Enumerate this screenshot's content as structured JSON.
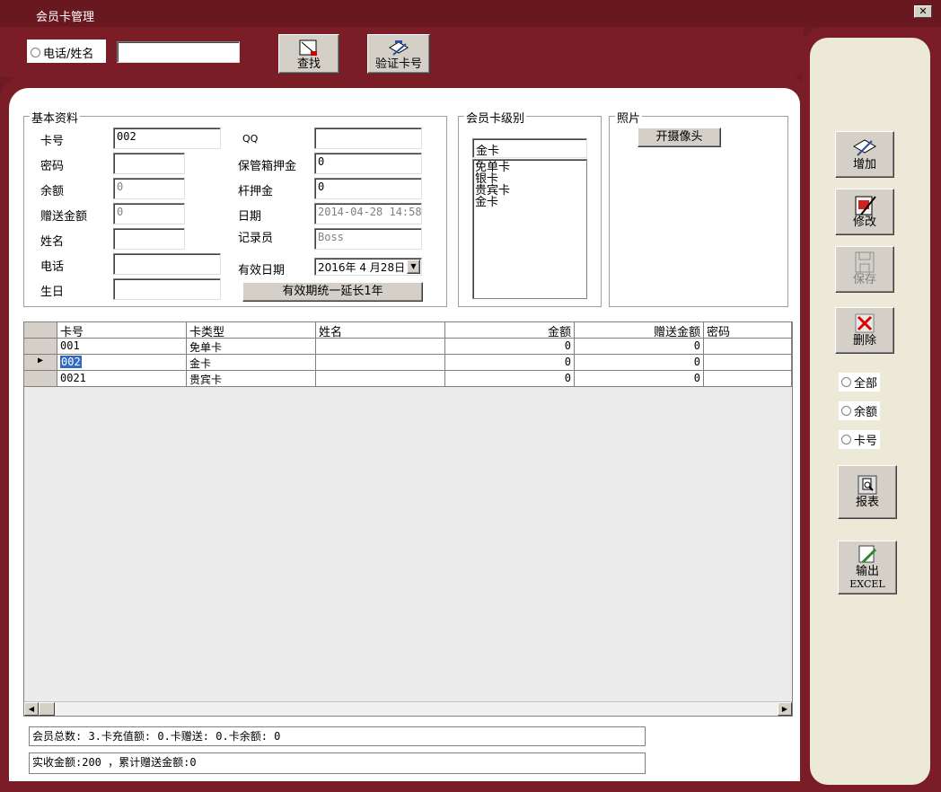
{
  "window": {
    "title": "会员卡管理",
    "close_label": "✕"
  },
  "toolbar": {
    "radio_label": "电话/姓名",
    "search_value": "",
    "find_label": "查找",
    "verify_label": "验证卡号"
  },
  "basic_info": {
    "title": "基本资料",
    "card_no_label": "卡号",
    "card_no": "002",
    "password_label": "密码",
    "password": "",
    "balance_label": "余额",
    "balance": "0",
    "gift_label": "赠送金额",
    "gift": "0",
    "name_label": "姓名",
    "name": "",
    "phone_label": "电话",
    "phone": "",
    "birthday_label": "生日",
    "birthday": "",
    "qq_label": "QQ",
    "qq": "",
    "locker_deposit_label": "保管箱押金",
    "locker_deposit": "0",
    "club_deposit_label": "杆押金",
    "club_deposit": "0",
    "date_label": "日期",
    "date": "2014-04-28 14:58",
    "recorder_label": "记录员",
    "recorder": "Boss",
    "valid_date_label": "有效日期",
    "valid_date": "2016年 4 月28日",
    "extend_button": "有效期统一延长1年"
  },
  "card_level": {
    "title": "会员卡级别",
    "selected": "金卡",
    "options": [
      "免单卡",
      "银卡",
      "贵宾卡",
      "金卡"
    ]
  },
  "photo": {
    "title": "照片",
    "camera_button": "开摄像头"
  },
  "grid": {
    "columns": [
      "卡号",
      "卡类型",
      "姓名",
      "金额",
      "赠送金额",
      "密码"
    ],
    "rows": [
      {
        "card_no": "001",
        "type": "免单卡",
        "name": "",
        "amount": "0",
        "gift": "0",
        "password": ""
      },
      {
        "card_no": "002",
        "type": "金卡",
        "name": "",
        "amount": "0",
        "gift": "0",
        "password": ""
      },
      {
        "card_no": "0021",
        "type": "贵宾卡",
        "name": "",
        "amount": "0",
        "gift": "0",
        "password": ""
      }
    ]
  },
  "status": {
    "line1": "会员总数: 3.卡充值额: 0.卡赠送: 0.卡余额: 0",
    "line2": "实收金额:200 ，累计赠送金额:0"
  },
  "sidebar": {
    "add_label": "增加",
    "edit_label": "修改",
    "save_label": "保存",
    "delete_label": "删除",
    "filters": [
      "全部",
      "余额",
      "卡号"
    ],
    "report_label": "报表",
    "export_label_1": "输出",
    "export_label_2": "EXCEL"
  }
}
